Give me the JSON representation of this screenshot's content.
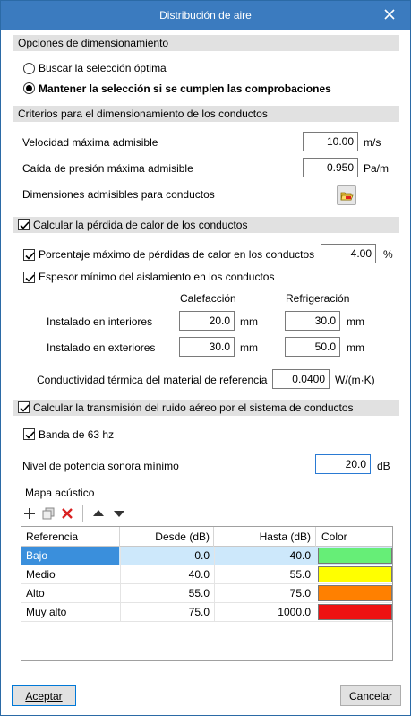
{
  "window": {
    "title": "Distribución de aire"
  },
  "sec_options": {
    "title": "Opciones de dimensionamiento",
    "radio1": "Buscar la selección óptima",
    "radio2": "Mantener la selección si se cumplen las comprobaciones"
  },
  "sec_criteria": {
    "title": "Criterios para el dimensionamiento de los conductos",
    "velocity_label": "Velocidad máxima admisible",
    "velocity_value": "10.00",
    "velocity_unit": "m/s",
    "pressure_label": "Caída de presión máxima admisible",
    "pressure_value": "0.950",
    "pressure_unit": "Pa/m",
    "dims_label": "Dimensiones admisibles para conductos"
  },
  "sec_heat": {
    "title": "Calcular la pérdida de calor de los conductos",
    "pct_label": "Porcentaje máximo de pérdidas de calor en los conductos",
    "pct_value": "4.00",
    "pct_unit": "%",
    "thick_label": "Espesor mínimo del aislamiento en los conductos",
    "col_heat": "Calefacción",
    "col_cool": "Refrigeración",
    "interior_label": "Instalado en interiores",
    "interior_heat": "20.0",
    "interior_cool": "30.0",
    "exterior_label": "Instalado en exteriores",
    "exterior_heat": "30.0",
    "exterior_cool": "50.0",
    "mm": "mm",
    "cond_label": "Conductividad térmica del material de referencia",
    "cond_value": "0.0400",
    "cond_unit": "W/(m·K)"
  },
  "sec_noise": {
    "title": "Calcular la transmisión del ruido aéreo por el sistema de conductos",
    "band_label": "Banda de 63 hz",
    "level_label": "Nivel de potencia sonora mínimo",
    "level_value": "20.0",
    "level_unit": "dB",
    "map_title": "Mapa acústico"
  },
  "table": {
    "headers": [
      "Referencia",
      "Desde (dB)",
      "Hasta (dB)",
      "Color"
    ],
    "rows": [
      {
        "ref": "Bajo",
        "from": "0.0",
        "to": "40.0",
        "color": "#66ee77"
      },
      {
        "ref": "Medio",
        "from": "40.0",
        "to": "55.0",
        "color": "#ffff00"
      },
      {
        "ref": "Alto",
        "from": "55.0",
        "to": "75.0",
        "color": "#ff8000"
      },
      {
        "ref": "Muy alto",
        "from": "75.0",
        "to": "1000.0",
        "color": "#ee1111"
      }
    ]
  },
  "footer": {
    "accept": "Aceptar",
    "cancel": "Cancelar"
  }
}
